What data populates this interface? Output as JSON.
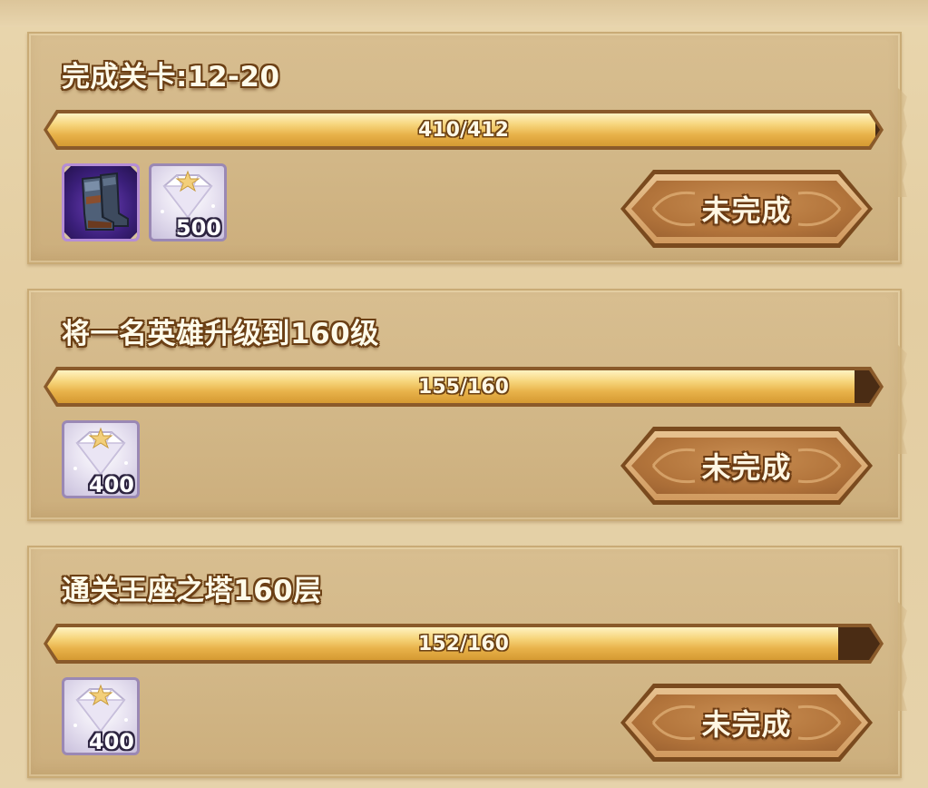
{
  "tasks": [
    {
      "title": "完成关卡:12-20",
      "progress_text": "410/412",
      "progress_fraction": 0.995,
      "rewards": [
        {
          "icon": "boots-icon",
          "count": ""
        },
        {
          "icon": "diamond-icon",
          "count": "500"
        }
      ],
      "status_label": "未完成"
    },
    {
      "title": "将一名英雄升级到160级",
      "progress_text": "155/160",
      "progress_fraction": 0.969,
      "rewards": [
        {
          "icon": "diamond-icon",
          "count": "400"
        }
      ],
      "status_label": "未完成"
    },
    {
      "title": "通关王座之塔160层",
      "progress_text": "152/160",
      "progress_fraction": 0.95,
      "rewards": [
        {
          "icon": "diamond-icon",
          "count": "400"
        }
      ],
      "status_label": "未完成"
    }
  ],
  "colors": {
    "card_bg": "#d2b787",
    "progress_fill": "#f0c160",
    "progress_empty": "#4a2c14",
    "button_bg": "#b2743b",
    "title_text": "#fffbea",
    "title_outline": "#6b3f14"
  }
}
